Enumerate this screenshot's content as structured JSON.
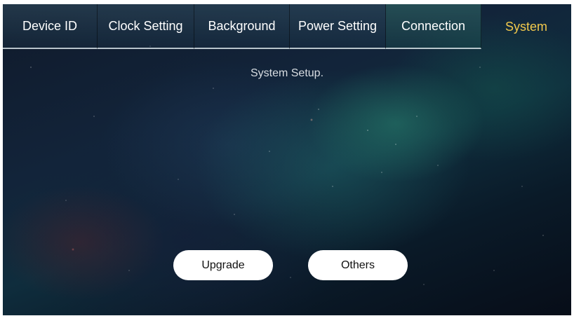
{
  "tabs": [
    {
      "label": "Device ID"
    },
    {
      "label": "Clock Setting"
    },
    {
      "label": "Background"
    },
    {
      "label": "Power Setting"
    },
    {
      "label": "Connection"
    },
    {
      "label": "System",
      "active": true
    }
  ],
  "main": {
    "subtitle": "System Setup.",
    "buttons": {
      "upgrade": "Upgrade",
      "others": "Others"
    }
  },
  "colors": {
    "active_tab": "#f2c94c",
    "tab_text": "#ffffff",
    "button_bg": "#ffffff"
  }
}
